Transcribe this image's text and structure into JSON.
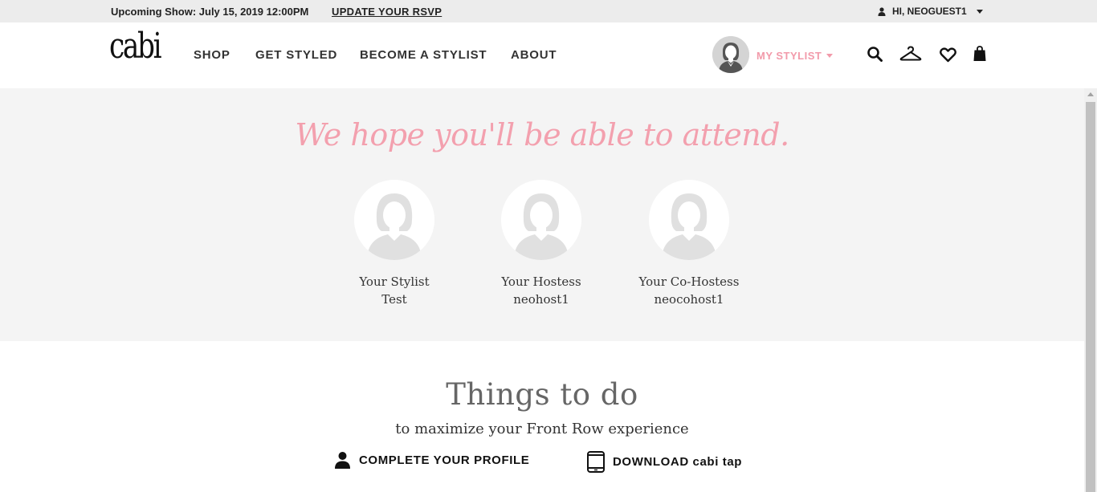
{
  "topbar": {
    "upcoming_show": "Upcoming Show: July 15, 2019 12:00PM",
    "rsvp_link": "UPDATE YOUR RSVP",
    "greeting": "HI, NEOGUEST1"
  },
  "header": {
    "logo": "cabi",
    "nav": [
      "SHOP",
      "GET STYLED",
      "BECOME A STYLIST",
      "ABOUT"
    ],
    "my_stylist": "MY STYLIST"
  },
  "hero": {
    "title": "We hope you'll be able to attend.",
    "people": [
      {
        "role": "Your Stylist",
        "name": "Test"
      },
      {
        "role": "Your Hostess",
        "name": "neohost1"
      },
      {
        "role": "Your Co-Hostess",
        "name": "neocohost1"
      }
    ]
  },
  "things": {
    "title": "Things to do",
    "subtitle": "to maximize your Front Row experience",
    "actions": [
      "COMPLETE YOUR PROFILE",
      "DOWNLOAD cabi tap"
    ]
  },
  "colors": {
    "accent_pink": "#f3a0ae",
    "hero_bg": "#f4f4f4",
    "topbar_bg": "#ececec"
  },
  "icons": [
    "user-icon",
    "chevron-down-icon",
    "search-icon",
    "hanger-icon",
    "heart-icon",
    "shopping-bag-icon",
    "profile-icon",
    "phone-icon"
  ]
}
